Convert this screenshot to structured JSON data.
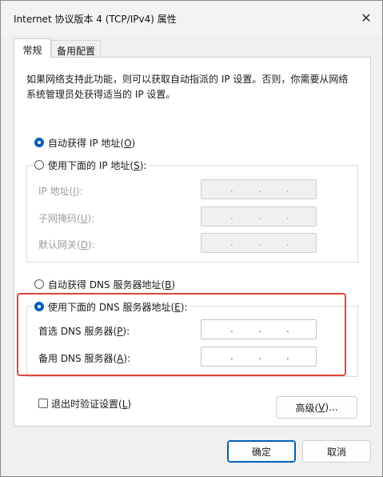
{
  "window": {
    "title": "Internet 协议版本 4 (TCP/IPv4) 属性",
    "close_glyph": "✕"
  },
  "tabs": [
    {
      "label": "常规",
      "active": true
    },
    {
      "label": "备用配置",
      "active": false
    }
  ],
  "description": "如果网络支持此功能，则可以获取自动指派的 IP 设置。否则，你需要从网络系统管理员处获得适当的 IP 设置。",
  "ip": {
    "auto_label": "自动获得 IP 地址(",
    "auto_key": "O",
    "auto_selected": true,
    "manual_label": "使用下面的 IP 地址(",
    "manual_key": "S",
    "manual_selected": false,
    "fields": [
      {
        "label": "IP 地址(",
        "key": "I",
        "suffix": "):"
      },
      {
        "label": "子网掩码(",
        "key": "U",
        "suffix": "):"
      },
      {
        "label": "默认网关(",
        "key": "D",
        "suffix": "):"
      }
    ]
  },
  "dns": {
    "auto_label": "自动获得 DNS 服务器地址(",
    "auto_key": "B",
    "auto_selected": false,
    "manual_label": "使用下面的 DNS 服务器地址(",
    "manual_key": "E",
    "manual_selected": true,
    "fields": [
      {
        "label": "首选 DNS 服务器(",
        "key": "P",
        "suffix": "):"
      },
      {
        "label": "备用 DNS 服务器(",
        "key": "A",
        "suffix": "):"
      }
    ]
  },
  "validate": {
    "label": "退出时验证设置(",
    "key": "L",
    "checked": false
  },
  "buttons": {
    "advanced_label": "高级(",
    "advanced_key": "V",
    "advanced_suffix": ")...",
    "ok_label": "确定",
    "cancel_label": "取消"
  },
  "colors": {
    "accent": "#005fb8",
    "highlight": "#e0453a"
  },
  "text_suffix": "):"
}
